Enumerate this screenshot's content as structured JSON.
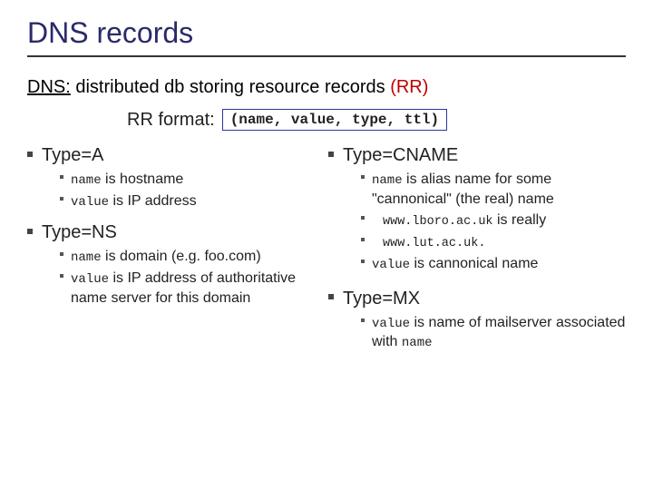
{
  "title": "DNS records",
  "subtitle_dns": "DNS:",
  "subtitle_rest": " distributed db storing resource records ",
  "subtitle_rr": "(RR)",
  "rr_format_label": "RR format:",
  "rr_format_box": "(name, value, type, ttl)",
  "left": {
    "typeA": {
      "head": "Type=A",
      "b1_pre": "name",
      "b1_post": " is hostname",
      "b2_pre": "value",
      "b2_post": " is IP address"
    },
    "typeNS": {
      "head": "Type=NS",
      "b1_pre": "name",
      "b1_post": " is domain (e.g. foo.com)",
      "b2_pre": "value",
      "b2_post": " is IP address of authoritative name server for this domain"
    }
  },
  "right": {
    "typeCNAME": {
      "head": "Type=CNAME",
      "b1_pre": "name",
      "b1_post": " is alias name for some \"cannonical\" (the real) name",
      "b2_mono_a": "www.lboro.ac.uk",
      "b2_post": " is really",
      "b3_mono": "www.lut.ac.uk.",
      "b4_pre": "value",
      "b4_post": " is cannonical name"
    },
    "typeMX": {
      "head": "Type=MX",
      "b1_pre": "value",
      "b1_mid": " is name of mailserver associated with ",
      "b1_post": "name"
    }
  }
}
